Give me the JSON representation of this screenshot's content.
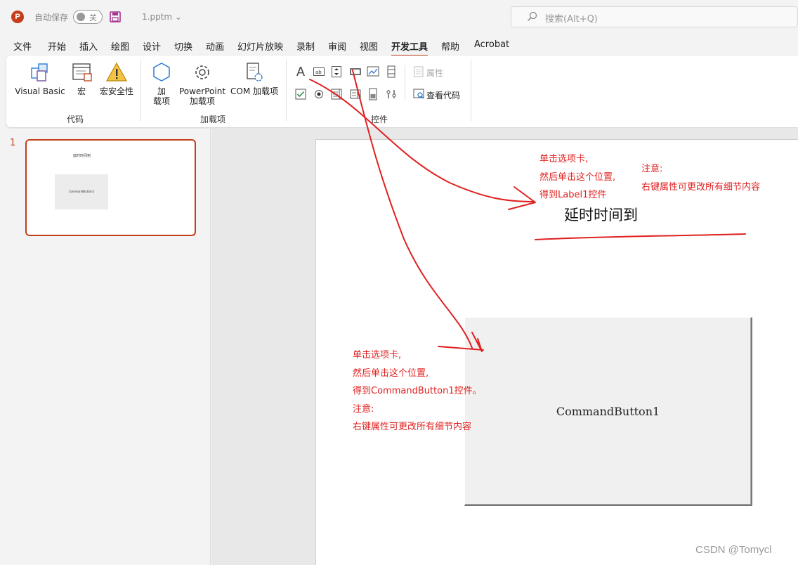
{
  "titlebar": {
    "app_icon_text": "P",
    "autosave_label": "自动保存",
    "autosave_state": "关",
    "filename": "1.pptm",
    "search_placeholder": "搜索(Alt+Q)"
  },
  "menu": {
    "tabs": [
      {
        "label": "文件"
      },
      {
        "label": "开始"
      },
      {
        "label": "插入"
      },
      {
        "label": "绘图"
      },
      {
        "label": "设计"
      },
      {
        "label": "切换"
      },
      {
        "label": "动画"
      },
      {
        "label": "幻灯片放映"
      },
      {
        "label": "录制"
      },
      {
        "label": "审阅"
      },
      {
        "label": "视图"
      },
      {
        "label": "开发工具"
      },
      {
        "label": "帮助"
      },
      {
        "label": "Acrobat"
      }
    ],
    "active_tab": "开发工具"
  },
  "ribbon": {
    "code_group": {
      "label": "代码",
      "visual_basic": "Visual Basic",
      "macro": "宏",
      "macro_security": "宏安全性"
    },
    "addins_group": {
      "label": "加载项",
      "addins_line1": "加",
      "addins_line2": "载项",
      "ppt_addins_line1": "PowerPoint",
      "ppt_addins_line2": "加载项",
      "com_addins": "COM 加载项"
    },
    "controls_group": {
      "label": "控件",
      "properties": "属性",
      "view_code": "查看代码"
    }
  },
  "slides_panel": {
    "slide_number": "1",
    "thumb_title": "延时时间到",
    "thumb_button": "CommandButton1"
  },
  "slide": {
    "label1_text": "延时时间到",
    "command_button_caption": "CommandButton1"
  },
  "annotations": {
    "top_note_lines": [
      "单击选项卡,",
      "然后单击这个位置,",
      "得到Label1控件"
    ],
    "right_note_lines": [
      "注意:",
      "右键属性可更改所有细节内容"
    ],
    "bottom_note_lines": [
      "单击选项卡,",
      "然后单击这个位置,",
      "得到CommandButton1控件。",
      "注意:",
      "右键属性可更改所有细节内容"
    ]
  },
  "watermark": "CSDN @Tomycl",
  "colors": {
    "accent": "#c43e1c",
    "annotation": "#e02020"
  }
}
